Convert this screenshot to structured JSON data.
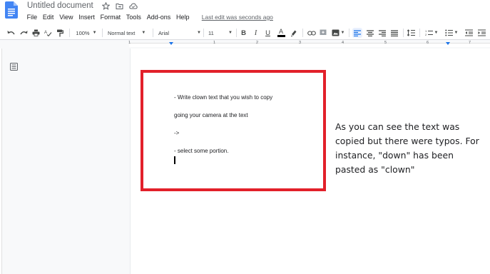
{
  "header": {
    "doc_title": "Untitled document",
    "title_icons": [
      "star-icon",
      "folder-move-icon",
      "cloud-status-icon"
    ],
    "menu": [
      "File",
      "Edit",
      "View",
      "Insert",
      "Format",
      "Tools",
      "Add-ons",
      "Help"
    ],
    "last_edit": "Last edit was seconds ago"
  },
  "toolbar": {
    "zoom": "100%",
    "style": "Normal text",
    "font": "Arial",
    "font_size": "11",
    "bold": "B",
    "italic": "I",
    "underline": "U",
    "text_color": "A"
  },
  "ruler": {
    "numbers": [
      "1",
      "1",
      "2",
      "3",
      "4",
      "5",
      "6",
      "7"
    ]
  },
  "pasted_image": {
    "border_color": "#e2202a",
    "lines": [
      "- Write clown text that you wish to copy",
      "going your camera at the text",
      "->",
      "- select some portion."
    ]
  },
  "document": {
    "annotation": "As you can see the text was copied but there were typos. For instance, \"down\" has been pasted as \"clown\""
  }
}
